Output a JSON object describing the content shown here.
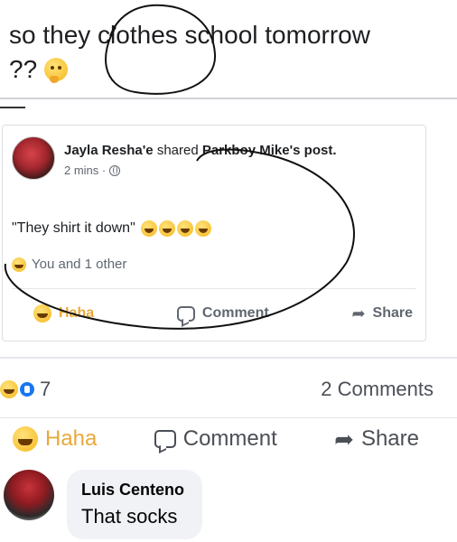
{
  "post": {
    "text_line1": "so they clothes school tomorrow",
    "text_line2": "??"
  },
  "shared_post": {
    "author": "Jayla Resha'e",
    "verb": "shared",
    "source": "Parkboy Mike's",
    "object": "post.",
    "time": "2 mins ·",
    "body": "\"They shirt it down\"",
    "reactions_text": "You and 1 other",
    "actions": {
      "haha": "Haha",
      "comment": "Comment",
      "share": "Share"
    }
  },
  "stats": {
    "reaction_count": "7",
    "comments": "2 Comments"
  },
  "actions": {
    "haha": "Haha",
    "comment": "Comment",
    "share": "Share"
  },
  "comment": {
    "author": "Luis Centeno",
    "text": "That socks"
  },
  "icons": {
    "thinking": "thinking-face-icon",
    "haha": "haha-icon",
    "like": "like-icon",
    "comment": "comment-icon",
    "share": "share-icon",
    "globe": "globe-icon"
  },
  "colors": {
    "haha_active": "#e8a93a",
    "like_blue": "#1877f2",
    "muted": "#606770"
  }
}
